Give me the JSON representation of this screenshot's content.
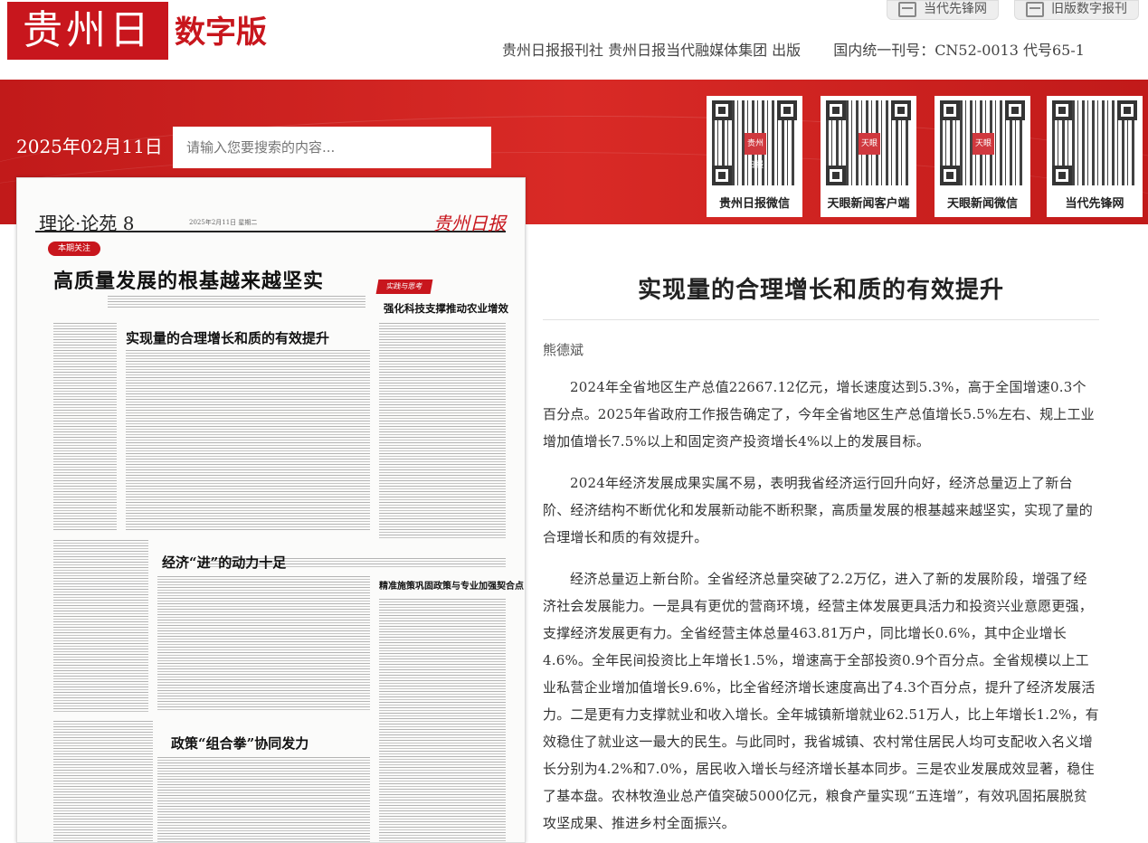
{
  "header": {
    "logo_text": "贵州日报",
    "logo_suffix": "数字版",
    "btn_current": "当代先锋网",
    "btn_old": "旧版数字报刊",
    "publisher": "贵州日报报刊社  贵州日报当代融媒体集团  出版",
    "issn": "国内统一刊号：CN52-0013  代号65-1"
  },
  "toolbar": {
    "date": "2025年02月11日",
    "search_placeholder": "请输入您要搜索的内容..."
  },
  "qrcodes": [
    {
      "label": "贵州日报微信",
      "mid": "贵州日报"
    },
    {
      "label": "天眼新闻客户端",
      "mid": "天眼"
    },
    {
      "label": "天眼新闻微信",
      "mid": "天眼"
    },
    {
      "label": "当代先锋网",
      "mid": ""
    }
  ],
  "page_preview": {
    "section": "理论·论苑",
    "page_no": "8",
    "dateline": "2025年2月11日  星期二",
    "paper_logo": "贵州日报",
    "tag": "本期关注",
    "headline": "高质量发展的根基越来越坚实",
    "side_tag": "实践与思考",
    "side_title": "强化科技支撑推动农业增效",
    "sub1": "实现量的合理增长和质的有效提升",
    "sub2": "经济“进”的动力十足",
    "sub3": "精准施策巩固政策与专业加强契合点",
    "sub4": "政策“组合拳”协同发力"
  },
  "article": {
    "title": "实现量的合理增长和质的有效提升",
    "author": "熊德斌",
    "paragraphs": [
      "2024年全省地区生产总值22667.12亿元，增长速度达到5.3%，高于全国增速0.3个百分点。2025年省政府工作报告确定了，今年全省地区生产总值增长5.5%左右、规上工业增加值增长7.5%以上和固定资产投资增长4%以上的发展目标。",
      "2024年经济发展成果实属不易，表明我省经济运行回升向好，经济总量迈上了新台阶、经济结构不断优化和发展新动能不断积聚，高质量发展的根基越来越坚实，实现了量的合理增长和质的有效提升。",
      "经济总量迈上新台阶。全省经济总量突破了2.2万亿，进入了新的发展阶段，增强了经济社会发展能力。一是具有更优的营商环境，经营主体发展更具活力和投资兴业意愿更强，支撑经济发展更有力。全省经营主体总量463.81万户，同比增长0.6%，其中企业增长4.6%。全年民间投资比上年增长1.5%，增速高于全部投资0.9个百分点。全省规模以上工业私营企业增加值增长9.6%，比全省经济增长速度高出了4.3个百分点，提升了经济发展活力。二是更有力支撑就业和收入增长。全年城镇新增就业62.51万人，比上年增长1.2%，有效稳住了就业这一最大的民生。与此同时，我省城镇、农村常住居民人均可支配收入名义增长分别为4.2%和7.0%，居民收入增长与经济增长基本同步。三是农业发展成效显著，稳住了基本盘。农林牧渔业总产值突破5000亿元，粮食产量实现“五连增”，有效巩固拓展脱贫攻坚成果、推进乡村全面振兴。"
    ]
  }
}
